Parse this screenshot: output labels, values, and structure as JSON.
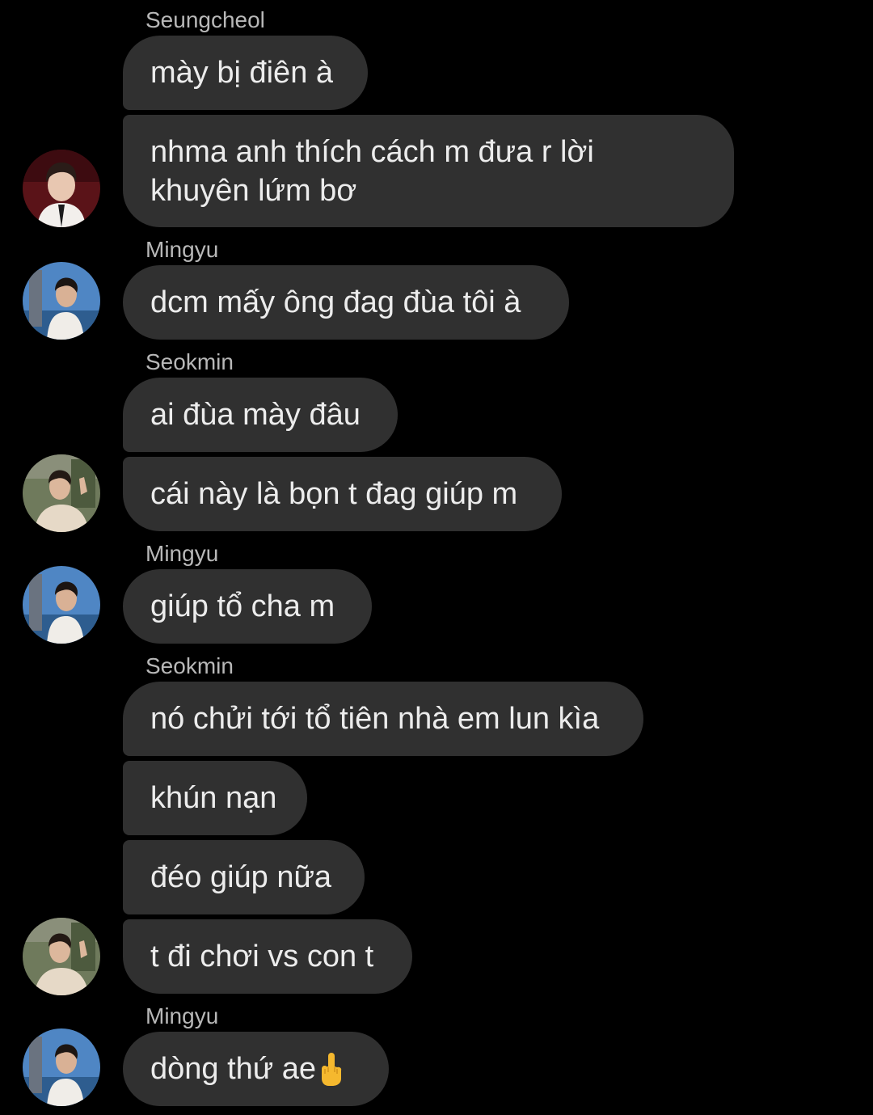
{
  "colors": {
    "background": "#000000",
    "bubble": "#303030",
    "sender_name": "#b8b8b8",
    "message_text": "#ececec"
  },
  "messages": [
    {
      "sender": "Seungcheol",
      "text": "mày bị điên à"
    },
    {
      "text": "nhma anh thích cách m đưa r lời khuyên lứm bơ",
      "avatar": "avatar-seungcheol"
    },
    {
      "sender": "Mingyu",
      "text": "dcm mấy ông đag đùa tôi à",
      "avatar": "avatar-mingyu"
    },
    {
      "sender": "Seokmin",
      "text": "ai đùa mày đâu"
    },
    {
      "text": "cái này là bọn t đag giúp m",
      "avatar": "avatar-seokmin"
    },
    {
      "sender": "Mingyu",
      "text": "giúp tổ cha m",
      "avatar": "avatar-mingyu"
    },
    {
      "sender": "Seokmin",
      "text": "nó chửi tới tổ tiên nhà em lun kìa"
    },
    {
      "text": "khún nạn"
    },
    {
      "text": "đéo giúp nữa"
    },
    {
      "text": "t đi chơi vs con t",
      "avatar": "avatar-seokmin"
    },
    {
      "sender": "Mingyu",
      "text": "dòng thứ ae",
      "emoji": "middle-finger-emoji-icon",
      "avatar": "avatar-mingyu"
    }
  ]
}
